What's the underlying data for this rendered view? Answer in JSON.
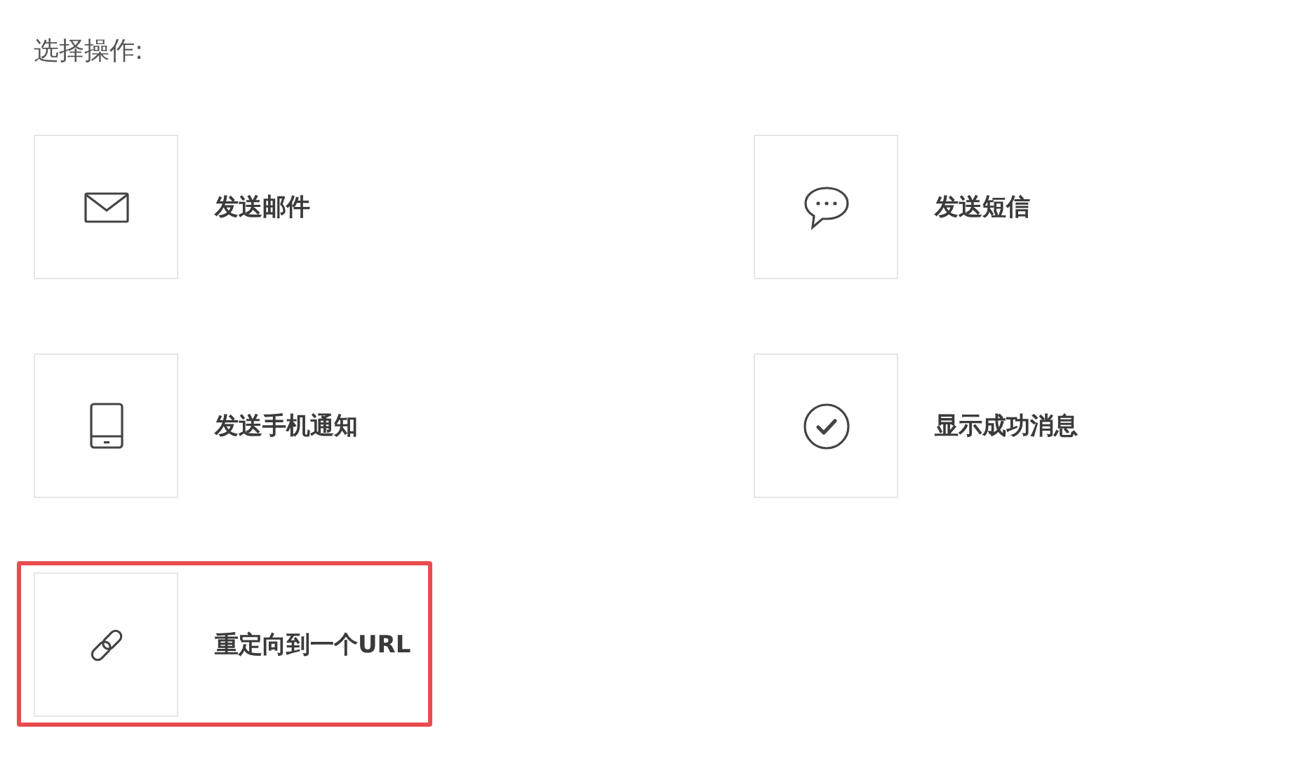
{
  "heading": "选择操作:",
  "actions": [
    {
      "kind": "mail",
      "label": "发送邮件",
      "highlighted": false
    },
    {
      "kind": "chat",
      "label": "发送短信",
      "highlighted": false
    },
    {
      "kind": "phone",
      "label": "发送手机通知",
      "highlighted": false
    },
    {
      "kind": "check",
      "label": "显示成功消息",
      "highlighted": false
    },
    {
      "kind": "link",
      "label": "重定向到一个URL",
      "highlighted": true
    }
  ]
}
